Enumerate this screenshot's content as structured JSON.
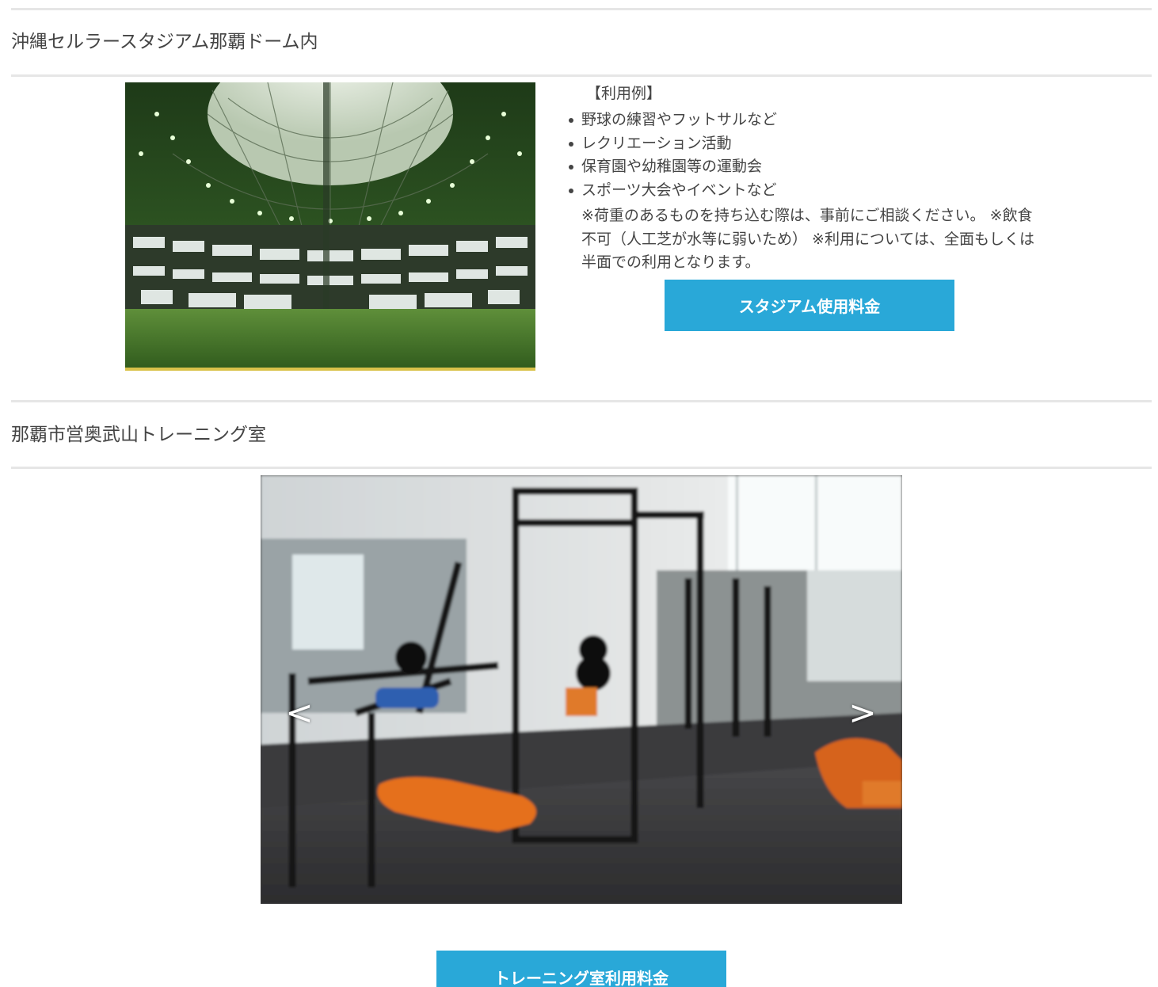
{
  "stadium_section": {
    "title": "沖縄セルラースタジアム那覇ドーム内",
    "example_label": "【利用例】",
    "examples": [
      "野球の練習やフットサルなど",
      "レクリエーション活動",
      "保育園や幼稚園等の運動会",
      "スポーツ大会やイベントなど"
    ],
    "note": "※荷重のあるものを持ち込む際は、事前にご相談ください。 ※飲食不可（人工芝が水等に弱いため） ※利用については、全面もしくは半面での利用となります。",
    "fee_button_label": "スタジアム使用料金"
  },
  "training_section": {
    "title": "那覇市営奥武山トレーニング室",
    "slider": {
      "prev_label": "<",
      "next_label": ">"
    },
    "fee_button_label": "トレーニング室利用料金"
  },
  "colors": {
    "accent": "#29a8d8",
    "divider": "#e6e6e6",
    "text": "#444444"
  }
}
